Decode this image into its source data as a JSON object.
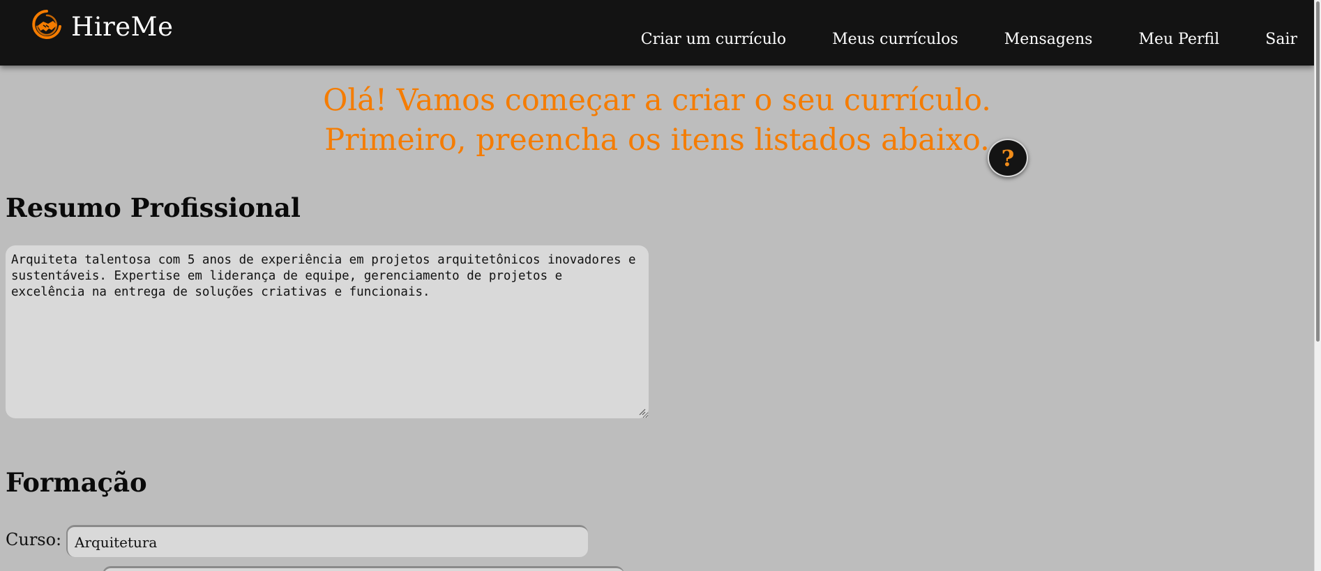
{
  "app": {
    "brand_name": "HireMe",
    "accent_color": "#f57c00",
    "navbar_color": "#131313",
    "page_background": "#bdbdbd"
  },
  "nav": {
    "items": [
      {
        "label": "Criar um currículo"
      },
      {
        "label": "Meus currículos"
      },
      {
        "label": "Mensagens"
      },
      {
        "label": "Meu Perfil"
      },
      {
        "label": "Sair"
      }
    ]
  },
  "hero": {
    "line1": "Olá! Vamos começar a criar o seu currículo.",
    "line2": "Primeiro, preencha os itens listados abaixo."
  },
  "help": {
    "icon": "question-icon",
    "label": "?"
  },
  "summary": {
    "title": "Resumo Profissional",
    "value": "Arquiteta talentosa com 5 anos de experiência em projetos arquitetônicos inovadores e sustentáveis. Expertise em liderança de equipe, gerenciamento de projetos e excelência na entrega de soluções criativas e funcionais."
  },
  "education": {
    "title": "Formação",
    "course_label": "Curso:",
    "course_value": "Arquitetura"
  }
}
